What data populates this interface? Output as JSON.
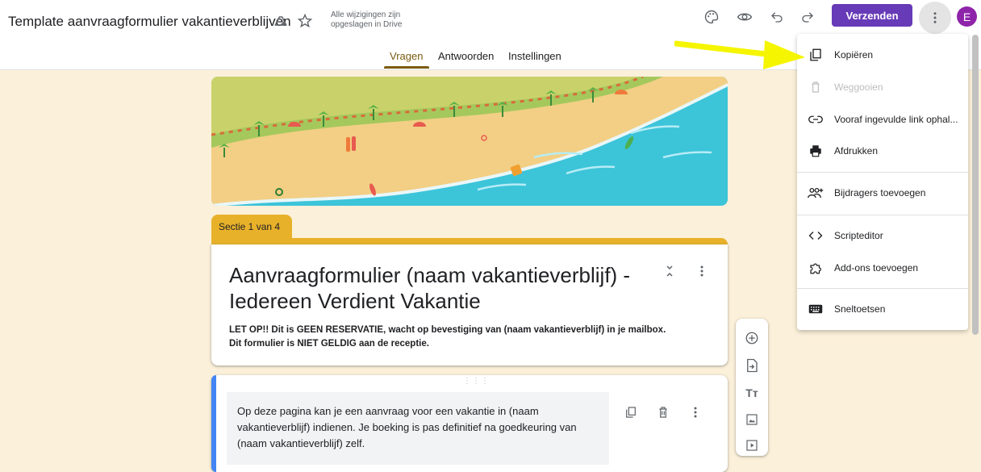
{
  "header": {
    "doc_title": "Template aanvraagformulier vakantieverblijven",
    "save_status_line1": "Alle wijzigingen zijn",
    "save_status_line2": "opgeslagen in Drive",
    "send_label": "Verzenden",
    "avatar_letter": "E",
    "icons": [
      "move-to-folder-icon",
      "star-icon",
      "palette-icon",
      "eye-preview-icon",
      "undo-icon",
      "redo-icon",
      "more-vert-icon"
    ]
  },
  "tabs": [
    {
      "label": "Vragen",
      "active": true
    },
    {
      "label": "Antwoorden",
      "active": false
    },
    {
      "label": "Instellingen",
      "active": false
    }
  ],
  "section": {
    "label": "Sectie 1 van 4"
  },
  "form": {
    "title": "Aanvraagformulier (naam vakantieverblijf) - Iedereen Verdient Vakantie",
    "desc_line1": "LET OP!! Dit is GEEN RESERVATIE, wacht op bevestiging van (naam vakantieverblijf) in je mailbox.",
    "desc_line2": "Dit formulier is NIET GELDIG aan de receptie."
  },
  "question": {
    "text": "Op deze pagina kan je een aanvraag voor een vakantie in (naam vakantieverblijf) indienen. Je boeking is pas definitief na goedkeuring van (naam vakantieverblijf) zelf."
  },
  "menu": {
    "items": [
      {
        "label": "Kopiëren",
        "icon": "copy-icon",
        "disabled": false
      },
      {
        "label": "Weggooien",
        "icon": "trash-icon",
        "disabled": true
      },
      {
        "label": "Vooraf ingevulde link ophal...",
        "icon": "link-icon",
        "disabled": false
      },
      {
        "label": "Afdrukken",
        "icon": "print-icon",
        "disabled": false
      },
      {
        "label": "Bijdragers toevoegen",
        "icon": "add-people-icon",
        "disabled": false
      },
      {
        "label": "Scripteditor",
        "icon": "code-icon",
        "disabled": false
      },
      {
        "label": "Add-ons toevoegen",
        "icon": "puzzle-icon",
        "disabled": false
      },
      {
        "label": "Sneltoetsen",
        "icon": "keyboard-icon",
        "disabled": false
      }
    ]
  },
  "colors": {
    "accent": "#673ab7",
    "theme": "#e8b12a",
    "background": "#fbf0d9",
    "avatar": "#8e24aa",
    "arrow": "#f5f500"
  }
}
